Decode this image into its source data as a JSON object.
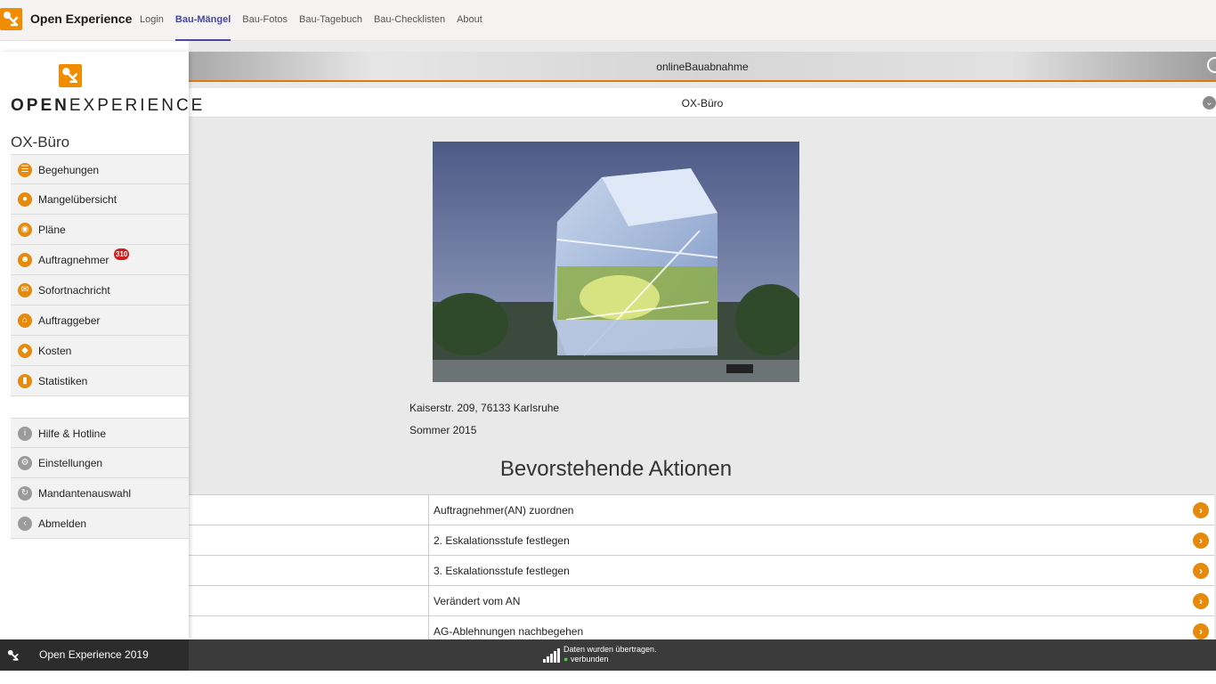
{
  "app": {
    "title": "Open Experience",
    "brand_color": "#f08c00"
  },
  "topnav": {
    "items": [
      {
        "label": "Login",
        "active": false
      },
      {
        "label": "Bau-Mängel",
        "active": true
      },
      {
        "label": "Bau-Fotos",
        "active": false
      },
      {
        "label": "Bau-Tagebuch",
        "active": false
      },
      {
        "label": "Bau-Checklisten",
        "active": false
      },
      {
        "label": "About",
        "active": false
      }
    ]
  },
  "sidebar": {
    "logo_text_bold": "OPEN",
    "logo_text_rest": "EXPERIENCE",
    "project": "OX-Büro",
    "menu": [
      {
        "label": "Begehungen",
        "icon": "list-icon"
      },
      {
        "label": "Mangelübersicht",
        "icon": "location-pin-icon"
      },
      {
        "label": "Pläne",
        "icon": "eye-icon"
      },
      {
        "label": "Auftragnehmer",
        "icon": "user-icon",
        "badge": "310"
      },
      {
        "label": "Sofortnachricht",
        "icon": "mail-icon"
      },
      {
        "label": "Auftraggeber",
        "icon": "home-icon"
      },
      {
        "label": "Kosten",
        "icon": "tag-icon"
      },
      {
        "label": "Statistiken",
        "icon": "bar-chart-icon"
      }
    ],
    "secondary_menu": [
      {
        "label": "Hilfe & Hotline",
        "icon": "info-icon"
      },
      {
        "label": "Einstellungen",
        "icon": "gear-icon"
      },
      {
        "label": "Mandantenauswahl",
        "icon": "switch-icon"
      },
      {
        "label": "Abmelden",
        "icon": "back-arrow-icon"
      }
    ]
  },
  "main": {
    "title": "onlineBauabnahme",
    "project": "OX-Büro",
    "address": "Kaiserstr. 209, 76133 Karlsruhe",
    "season": "Sommer 2015",
    "section_heading": "Bevorstehende Aktionen",
    "actions": [
      {
        "label": "Auftragnehmer(AN) zuordnen"
      },
      {
        "label": "2. Eskalationsstufe festlegen"
      },
      {
        "label": "3. Eskalationsstufe festlegen"
      },
      {
        "label": "Verändert vom AN"
      },
      {
        "label": "AG-Ablehnungen nachbegehen"
      }
    ]
  },
  "footer": {
    "title": "Open Experience 2019",
    "status_line1": "Daten wurden übertragen.",
    "status_line2": "verbunden"
  }
}
